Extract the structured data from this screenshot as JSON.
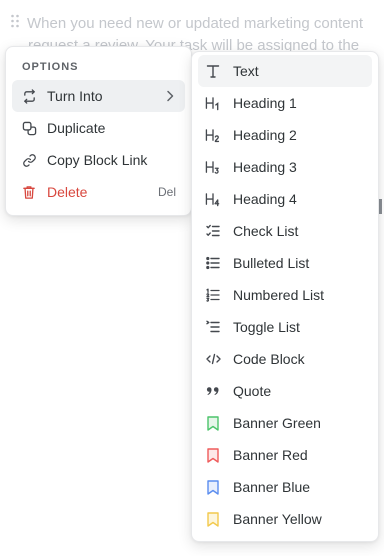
{
  "background": {
    "lines": [
      "When you need new or updated marketing content",
      "request a review. Your task will be assigned to the"
    ]
  },
  "options_menu": {
    "title": "OPTIONS",
    "items": [
      {
        "label": "Turn Into",
        "icon": "refresh-icon",
        "has_submenu": true
      },
      {
        "label": "Duplicate",
        "icon": "duplicate-icon"
      },
      {
        "label": "Copy Block Link",
        "icon": "link-icon"
      },
      {
        "label": "Delete",
        "icon": "trash-icon",
        "shortcut": "Del",
        "color": "#d8473e"
      }
    ]
  },
  "turn_into_menu": {
    "items": [
      {
        "label": "Text",
        "icon": "text-icon"
      },
      {
        "label": "Heading 1",
        "icon": "heading-1-icon"
      },
      {
        "label": "Heading 2",
        "icon": "heading-2-icon"
      },
      {
        "label": "Heading 3",
        "icon": "heading-3-icon"
      },
      {
        "label": "Heading 4",
        "icon": "heading-4-icon"
      },
      {
        "label": "Check List",
        "icon": "check-list-icon"
      },
      {
        "label": "Bulleted List",
        "icon": "bulleted-list-icon"
      },
      {
        "label": "Numbered List",
        "icon": "numbered-list-icon"
      },
      {
        "label": "Toggle List",
        "icon": "toggle-list-icon"
      },
      {
        "label": "Code Block",
        "icon": "code-block-icon"
      },
      {
        "label": "Quote",
        "icon": "quote-icon"
      },
      {
        "label": "Banner Green",
        "icon": "banner-green-icon",
        "color": "#4cc46b"
      },
      {
        "label": "Banner Red",
        "icon": "banner-red-icon",
        "color": "#ef5b5b"
      },
      {
        "label": "Banner Blue",
        "icon": "banner-blue-icon",
        "color": "#5b8def"
      },
      {
        "label": "Banner Yellow",
        "icon": "banner-yellow-icon",
        "color": "#f2c94c"
      }
    ]
  }
}
